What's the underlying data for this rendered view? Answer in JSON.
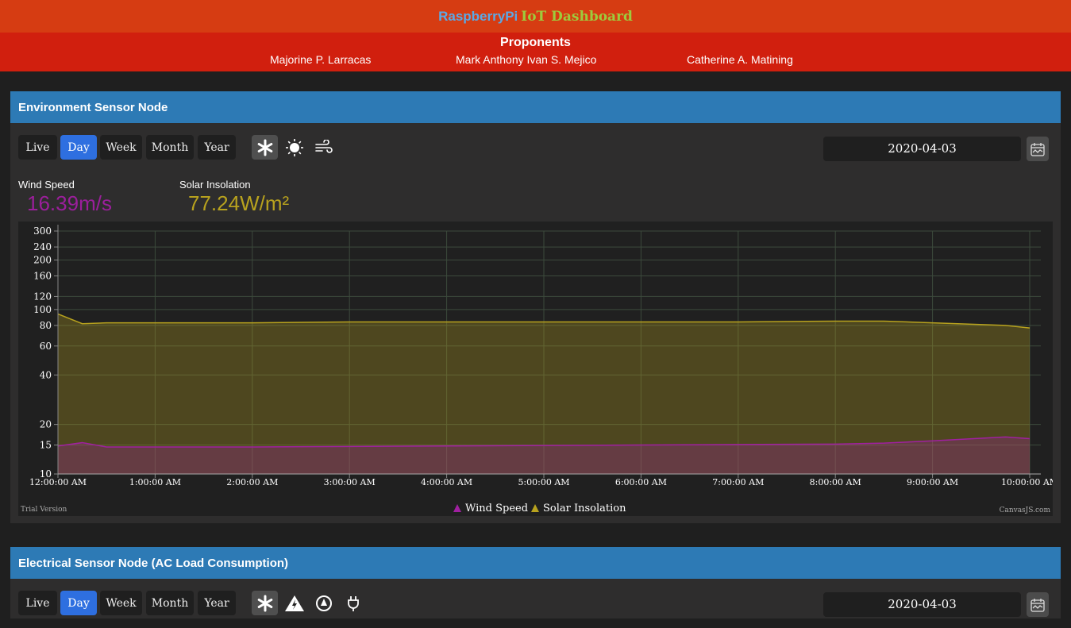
{
  "header": {
    "title_part1": "RaspberryPi",
    "title_part2": "IoT Dashboard"
  },
  "proponents": {
    "title": "Proponents",
    "names": [
      "Majorine P. Larracas",
      "Mark Anthony Ivan S. Mejico",
      "Catherine A. Matining"
    ]
  },
  "env_panel": {
    "title": "Environment Sensor Node",
    "periods": [
      "Live",
      "Day",
      "Week",
      "Month",
      "Year"
    ],
    "active_period": "Day",
    "icons": [
      "snowflake-icon",
      "sun-icon",
      "wind-icon"
    ],
    "date": "2020-04-03",
    "wind_label": "Wind Speed",
    "wind_value": "16.39m/s",
    "solar_label": "Solar Insolation",
    "solar_value": "77.24W/m²",
    "colors": {
      "wind": "#9b1f9b",
      "solar": "#b8a21e"
    }
  },
  "elec_panel": {
    "title": "Electrical Sensor Node (AC Load Consumption)",
    "periods": [
      "Live",
      "Day",
      "Week",
      "Month",
      "Year"
    ],
    "active_period": "Day",
    "icons": [
      "snowflake-icon",
      "lightning-icon",
      "gauge-icon",
      "plug-icon"
    ],
    "date": "2020-04-03"
  },
  "chart_data": {
    "type": "area",
    "y_scale": "log",
    "ylim": [
      10,
      300
    ],
    "yticks": [
      10,
      15,
      20,
      40,
      60,
      80,
      100,
      120,
      160,
      200,
      240,
      300
    ],
    "xticks": [
      "12:00:00 AM",
      "1:00:00 AM",
      "2:00:00 AM",
      "3:00:00 AM",
      "4:00:00 AM",
      "5:00:00 AM",
      "6:00:00 AM",
      "7:00:00 AM",
      "8:00:00 AM",
      "9:00:00 AM",
      "10:00:00 AM"
    ],
    "grid": true,
    "legend_position": "bottom",
    "watermark_left": "Trial Version",
    "watermark_right": "CanvasJS.com",
    "series": [
      {
        "name": "Wind Speed",
        "color": "#a020a0",
        "x": [
          "12:00 AM",
          "12:15 AM",
          "12:30 AM",
          "12:45 AM",
          "1:00 AM",
          "2:00 AM",
          "3:00 AM",
          "4:00 AM",
          "5:00 AM",
          "6:00 AM",
          "7:00 AM",
          "8:00 AM",
          "8:30 AM",
          "9:00 AM",
          "9:45 AM",
          "10:00 AM"
        ],
        "values": [
          14.8,
          15.5,
          14.6,
          14.6,
          14.6,
          14.6,
          14.7,
          14.8,
          14.9,
          15.0,
          15.1,
          15.2,
          15.4,
          15.9,
          16.8,
          16.4
        ]
      },
      {
        "name": "Solar Insolation",
        "color": "#b8a21e",
        "x": [
          "12:00 AM",
          "12:15 AM",
          "12:30 AM",
          "12:45 AM",
          "1:00 AM",
          "2:00 AM",
          "3:00 AM",
          "4:00 AM",
          "5:00 AM",
          "6:00 AM",
          "7:00 AM",
          "8:00 AM",
          "8:30 AM",
          "9:00 AM",
          "9:45 AM",
          "10:00 AM"
        ],
        "values": [
          94,
          82,
          83,
          83,
          83,
          83,
          84,
          84,
          84,
          84,
          84,
          85,
          85,
          83,
          80,
          77.24
        ]
      }
    ]
  }
}
